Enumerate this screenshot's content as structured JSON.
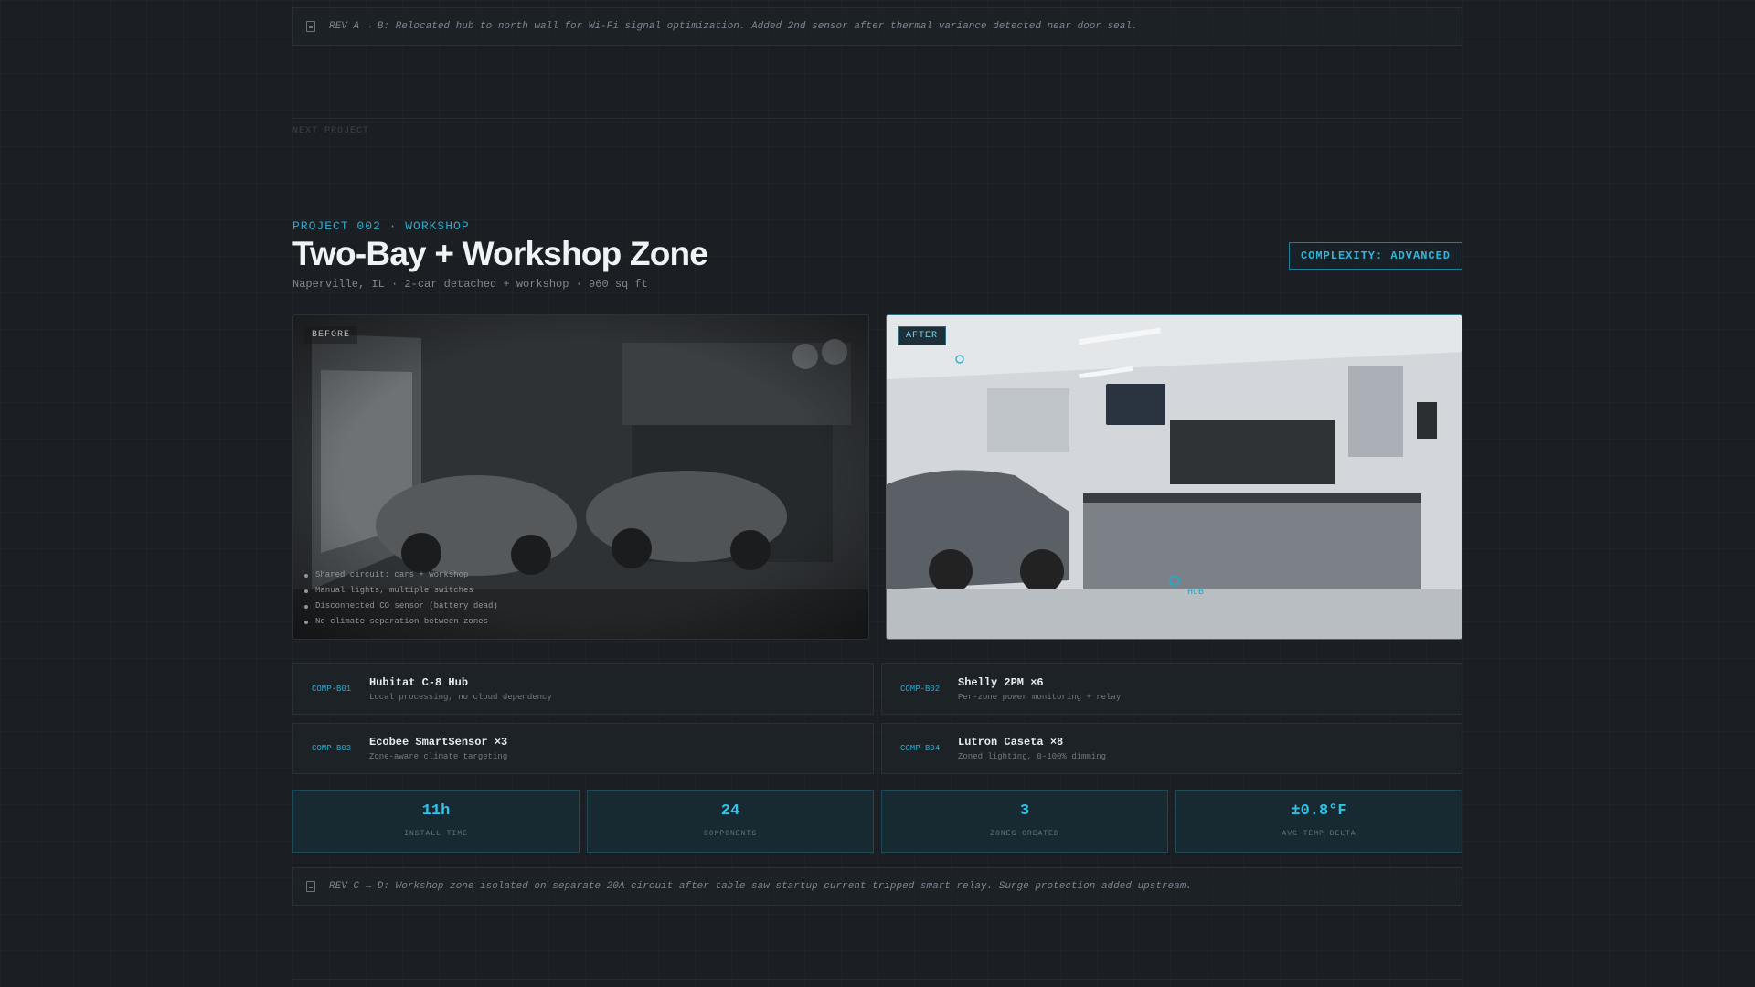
{
  "top_note": "REV A → B: Relocated hub to north wall for Wi-Fi signal optimization. Added 2nd sensor after thermal variance detected near door seal.",
  "next_project_label": "NEXT PROJECT",
  "project": {
    "eyebrow": "PROJECT 002 · WORKSHOP",
    "title": "Two-Bay + Workshop Zone",
    "subtitle": "Naperville, IL · 2-car detached + workshop · 960 sq ft",
    "complexity": "COMPLEXITY: ADVANCED"
  },
  "before": {
    "tag": "BEFORE",
    "bullets": [
      "Shared circuit: cars + workshop",
      "Manual lights, multiple switches",
      "Disconnected CO sensor (battery dead)",
      "No climate separation between zones"
    ]
  },
  "after": {
    "tag": "AFTER",
    "hub_label": "HUB"
  },
  "components": [
    {
      "code": "COMP-B01",
      "name": "Hubitat C-8 Hub",
      "desc": "Local processing, no cloud dependency"
    },
    {
      "code": "COMP-B02",
      "name": "Shelly 2PM ×6",
      "desc": "Per-zone power monitoring + relay"
    },
    {
      "code": "COMP-B03",
      "name": "Ecobee SmartSensor ×3",
      "desc": "Zone-aware climate targeting"
    },
    {
      "code": "COMP-B04",
      "name": "Lutron Caseta ×8",
      "desc": "Zoned lighting, 0-100% dimming"
    }
  ],
  "stats": [
    {
      "value": "11h",
      "label": "INSTALL TIME"
    },
    {
      "value": "24",
      "label": "COMPONENTS"
    },
    {
      "value": "3",
      "label": "ZONES CREATED"
    },
    {
      "value": "±0.8°F",
      "label": "AVG TEMP DELTA"
    }
  ],
  "bottom_note": "REV C → D: Workshop zone isolated on separate 20A circuit after table saw startup current tripped smart relay. Surge protection added upstream.",
  "colors": {
    "background": "#1b1f23",
    "accent": "#2ec3e8",
    "title": "#f0f3f6",
    "muted": "#7e8891"
  }
}
